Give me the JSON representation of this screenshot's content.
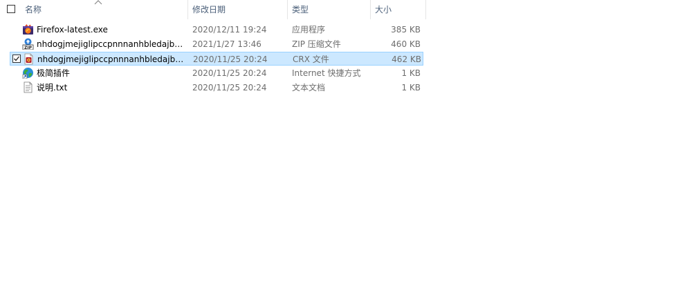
{
  "columns": {
    "name": "名称",
    "date": "修改日期",
    "type": "类型",
    "size": "大小"
  },
  "sort": {
    "column": "name",
    "direction": "ascending",
    "icon": "chevron-up-icon"
  },
  "files": [
    {
      "name": "Firefox-latest.exe",
      "date": "2020/12/11 19:24",
      "type": "应用程序",
      "size": "385 KB",
      "icon": "firefox-app-icon",
      "selected": false
    },
    {
      "name": "nhdogjmejiglipccpnnnanhbledajbp...",
      "date": "2021/1/27 13:46",
      "type": "ZIP 压缩文件",
      "size": "460 KB",
      "icon": "zip-archive-icon",
      "selected": false
    },
    {
      "name": "nhdogjmejiglipccpnnnanhbledajbp...",
      "date": "2020/11/25 20:24",
      "type": "CRX 文件",
      "size": "462 KB",
      "icon": "crx-file-icon",
      "selected": true
    },
    {
      "name": "极简插件",
      "date": "2020/11/25 20:24",
      "type": "Internet 快捷方式",
      "size": "1 KB",
      "icon": "internet-shortcut-icon",
      "selected": false
    },
    {
      "name": "说明.txt",
      "date": "2020/11/25 20:24",
      "type": "文本文档",
      "size": "1 KB",
      "icon": "text-document-icon",
      "selected": false
    }
  ],
  "colors": {
    "selection_bg": "#cce8ff",
    "selection_border": "#99d1ff",
    "header_text": "#4c607a",
    "detail_text": "#6d6d6d"
  }
}
